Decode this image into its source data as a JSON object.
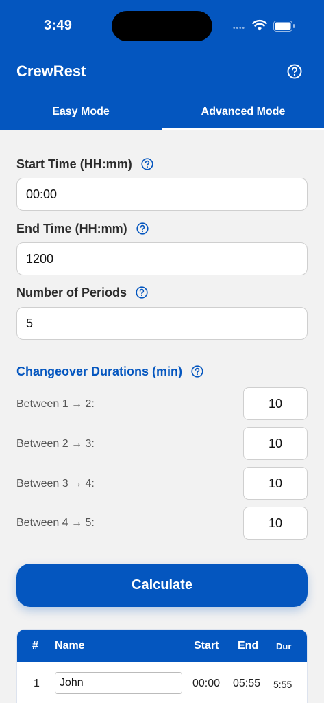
{
  "status_bar": {
    "time": "3:49",
    "signal_dots": "••••"
  },
  "app": {
    "title": "CrewRest"
  },
  "tabs": [
    {
      "label": "Easy Mode"
    },
    {
      "label": "Advanced Mode"
    }
  ],
  "form": {
    "start_time": {
      "label": "Start Time (HH:mm)",
      "value": "00:00"
    },
    "end_time": {
      "label": "End Time (HH:mm)",
      "value": "1200"
    },
    "periods": {
      "label": "Number of Periods",
      "value": "5"
    }
  },
  "changeover": {
    "title": "Changeover Durations (min)",
    "rows": [
      {
        "label": "Between 1 → 2:",
        "value": "10"
      },
      {
        "label": "Between 2 → 3:",
        "value": "10"
      },
      {
        "label": "Between 3 → 4:",
        "value": "10"
      },
      {
        "label": "Between 4 → 5:",
        "value": "10"
      }
    ]
  },
  "calculate_label": "Calculate",
  "table": {
    "headers": {
      "index": "#",
      "name": "Name",
      "start": "Start",
      "end": "End",
      "duration": "Dur"
    },
    "rows": [
      {
        "index": "1",
        "name": "John",
        "start": "00:00",
        "end": "05:55",
        "duration": "5:55"
      }
    ]
  },
  "colors": {
    "brand": "#0456bf",
    "background": "#f2f2f2"
  }
}
